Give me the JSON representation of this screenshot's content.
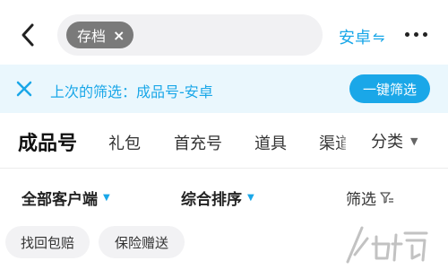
{
  "header": {
    "search_tag": "存档",
    "search_tag_remove": "×",
    "platform_label": "安卓",
    "platform_swap_icon": "⇋"
  },
  "banner": {
    "text": "上次的筛选：成品号-安卓",
    "button_label": "一键筛选"
  },
  "tabs": {
    "items": [
      {
        "label": "成品号",
        "active": true
      },
      {
        "label": "礼包"
      },
      {
        "label": "首充号"
      },
      {
        "label": "道具"
      },
      {
        "label": "渠道"
      }
    ],
    "category_label": "分类",
    "category_caret": "▼"
  },
  "sort": {
    "client_label": "全部客户端",
    "order_label": "综合排序",
    "caret": "▼",
    "filter_label": "筛选"
  },
  "chips": [
    {
      "label": "找回包赔"
    },
    {
      "label": "保险赠送"
    }
  ],
  "colors": {
    "accent": "#1aa7e8",
    "banner_bg": "#eaf7fd",
    "chip_bg": "#f2f2f4",
    "tag_bg": "#7a7a7a"
  }
}
